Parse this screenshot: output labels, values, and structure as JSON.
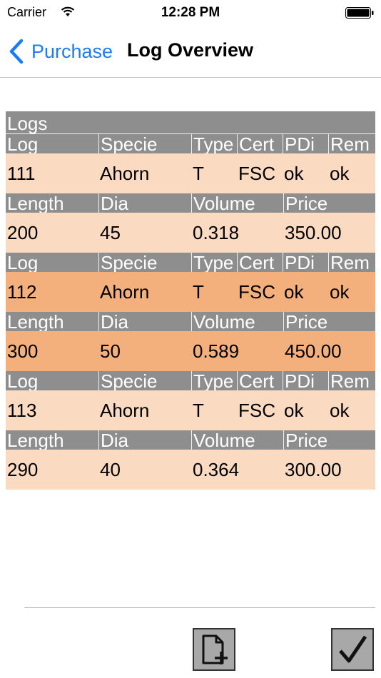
{
  "status_bar": {
    "carrier": "Carrier",
    "time": "12:28 PM"
  },
  "nav": {
    "back_label": "Purchase",
    "title": "Log Overview"
  },
  "table": {
    "title": "Logs",
    "header1": [
      "Log",
      "Specie",
      "Type",
      "Cert",
      "PDi",
      "Rem"
    ],
    "header2": [
      "Length",
      "Dia",
      "Volume",
      "Price"
    ],
    "logs": [
      {
        "log": "111",
        "specie": "Ahorn",
        "type": "T",
        "cert": "FSC",
        "pdi": "ok",
        "rem": "ok",
        "length": "200",
        "dia": "45",
        "volume": "0.318",
        "price": "350.00"
      },
      {
        "log": "112",
        "specie": "Ahorn",
        "type": "T",
        "cert": "FSC",
        "pdi": "ok",
        "rem": "ok",
        "length": "300",
        "dia": "50",
        "volume": "0.589",
        "price": "450.00"
      },
      {
        "log": "113",
        "specie": "Ahorn",
        "type": "T",
        "cert": "FSC",
        "pdi": "ok",
        "rem": "ok",
        "length": "290",
        "dia": "40",
        "volume": "0.364",
        "price": "300.00"
      }
    ]
  },
  "toolbar": {
    "add_icon": "new-document-icon",
    "confirm_icon": "checkmark-icon"
  },
  "colors": {
    "accent": "#1a7cf6",
    "header_gray": "#8e8e8e",
    "row_light": "#fadac1",
    "row_selected": "#f4b07c"
  }
}
